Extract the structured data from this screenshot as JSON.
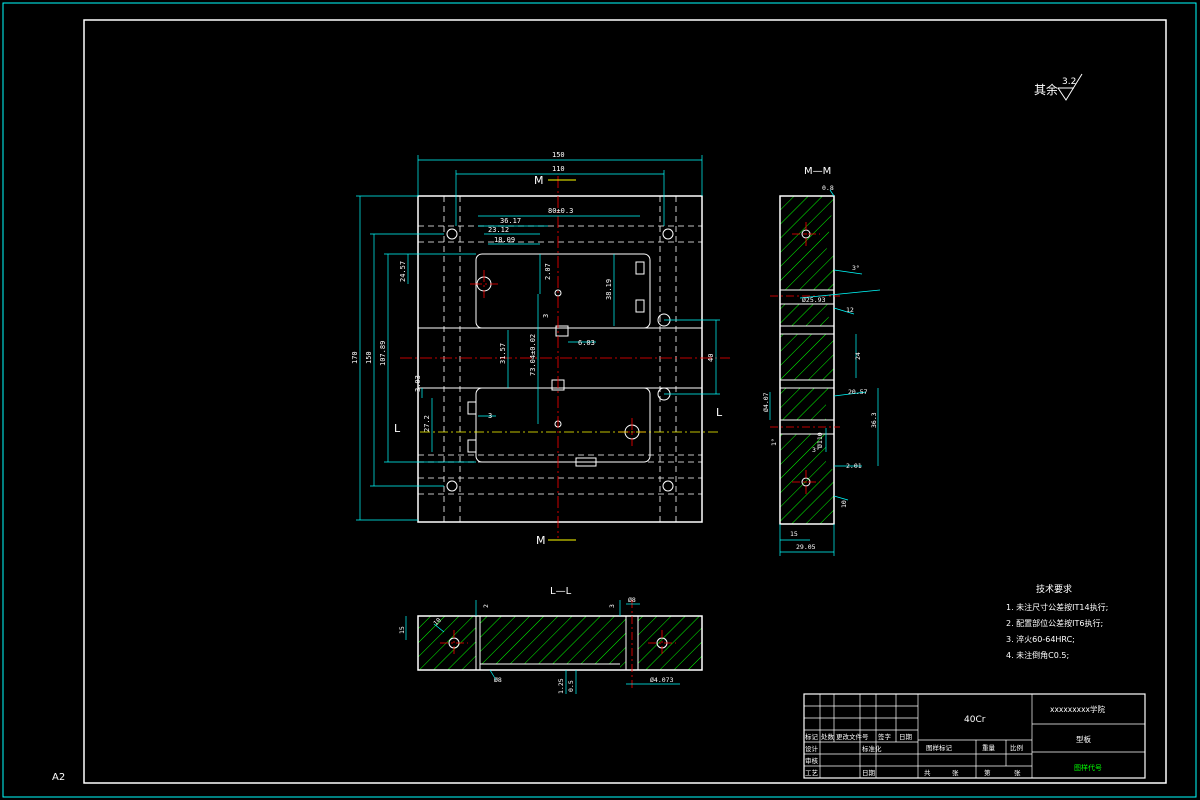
{
  "sheet": {
    "size_label": "A2"
  },
  "roughness": {
    "label": "其余",
    "value": "3.2"
  },
  "main_view": {
    "dims": {
      "w150": "150",
      "w110": "110",
      "d36": "36.17",
      "d23": "23.12",
      "d18": "18.09",
      "d80": "80±0.3",
      "h170": "170",
      "h150": "150",
      "h107": "107.89",
      "h24": "24.57",
      "v207a": "2.07",
      "v38": "38.19",
      "v6": "6.03",
      "v3a": "3",
      "v31": "31.57",
      "v73": "73.04±0.02",
      "v40": "40",
      "v3b": "3.03",
      "v272": "27.2",
      "v3c": "3"
    },
    "section_m_label": "M",
    "section_l_label": "L"
  },
  "view_mm": {
    "title": "M—M",
    "dims": {
      "d08": "0.8",
      "d3deg": "3°",
      "d25": "Ø25.93",
      "d12": "12",
      "d24": "24",
      "d20": "20.57",
      "d4": "Ø4.07",
      "d1": "1°",
      "d110": "Ø110",
      "d363": "36.3",
      "d3b": "3°",
      "d2": "2.01",
      "d15": "15",
      "d2905": "29.05",
      "d10": "10"
    }
  },
  "view_ll": {
    "title": "L—L",
    "dims": {
      "d2": "2",
      "d3": "3",
      "d8": "Ø8",
      "d15": "15",
      "d88": "Ø8",
      "d125": "1.25",
      "d05": "0.5",
      "d4": "Ø4.073",
      "d10": "10"
    }
  },
  "tech_requirements": {
    "title": "技术要求",
    "items": [
      "1. 未注尺寸公差按IT14执行;",
      "2. 配置部位公差按IT6执行;",
      "3. 淬火60-64HRC;",
      "4. 未注倒角C0.5;"
    ]
  },
  "title_block": {
    "material": "40Cr",
    "school": "xxxxxxxxx学院",
    "part_name": "型板",
    "drawing_no": "图样代号",
    "left_rows": [
      [
        "标记",
        "处数",
        "更改文件号",
        "签字",
        "日期"
      ],
      [
        "设计",
        "",
        "标准化",
        "",
        ""
      ],
      [
        "审核",
        "",
        "",
        "",
        ""
      ],
      [
        "工艺",
        "",
        "日期",
        "",
        ""
      ]
    ],
    "mid_headers": [
      "图样标记",
      "重量",
      "比例"
    ],
    "sheet_row": [
      "共",
      "张",
      "第",
      "张"
    ]
  },
  "colors": {
    "frame": "#00ffff",
    "outline": "#ffffff",
    "hatch": "#00ff00",
    "center": "#ff0000",
    "dim": "#00ffff",
    "yellow": "#ffff00"
  }
}
